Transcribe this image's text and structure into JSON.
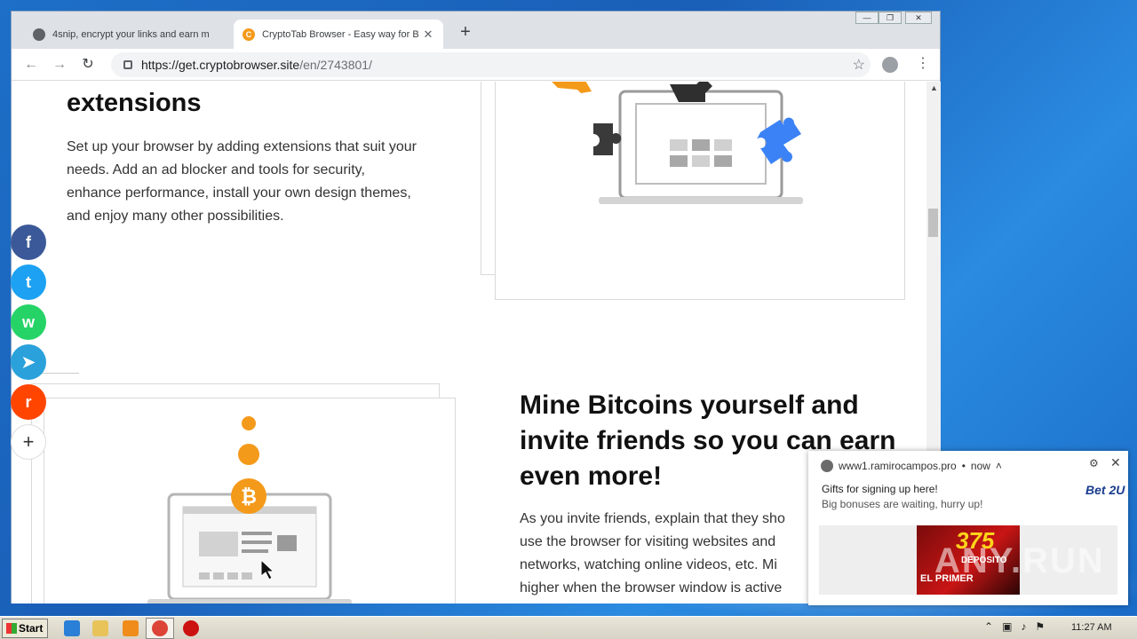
{
  "browser": {
    "tabs": [
      {
        "title": "4snip, encrypt your links and earn m",
        "active": false
      },
      {
        "title": "CryptoTab Browser - Easy way for B",
        "active": true
      }
    ],
    "new_tab": "+",
    "close_glyph": "✕",
    "url_host": "https://get.cryptobrowser.site",
    "url_path": "/en/2743801/",
    "window_controls": [
      "—",
      "❐",
      "✕"
    ]
  },
  "page": {
    "extensions_heading": "extensions",
    "extensions_text": "Set up your browser by adding extensions that suit your needs. Add an ad blocker and tools for security, enhance performance, install your own design themes, and enjoy many other possibilities.",
    "mine_heading": "Mine Bitcoins yourself and invite friends so you can earn even more!",
    "mine_lines": [
      "As you invite friends, explain that they sho",
      "use the browser for visiting websites and",
      "networks, watching online videos, etc. Mi",
      "higher when the browser window is active"
    ],
    "share_buttons": [
      {
        "label": "f",
        "icon": "facebook-icon"
      },
      {
        "label": "t",
        "icon": "twitter-icon"
      },
      {
        "label": "w",
        "icon": "whatsapp-icon"
      },
      {
        "label": "➤",
        "icon": "telegram-icon"
      },
      {
        "label": "r",
        "icon": "reddit-icon"
      },
      {
        "label": "+",
        "icon": "plus-icon"
      }
    ]
  },
  "notification": {
    "source": "www1.ramirocampos.pro",
    "time": "now",
    "title": "Gifts for signing up here!",
    "body": "Big bonuses are waiting, hurry up!",
    "brand": "Bet 2U",
    "ad_big": "375",
    "ad_small": "DEPOSITO",
    "ad_line": "EL PRIMER",
    "watermark": "ANY.RUN"
  },
  "taskbar": {
    "start_label": "Start",
    "clock": "11:27 AM"
  },
  "colors": {
    "bitcoin_orange": "#f49a1a",
    "puzzle_blue": "#3b82f6",
    "puzzle_dark": "#333333"
  }
}
